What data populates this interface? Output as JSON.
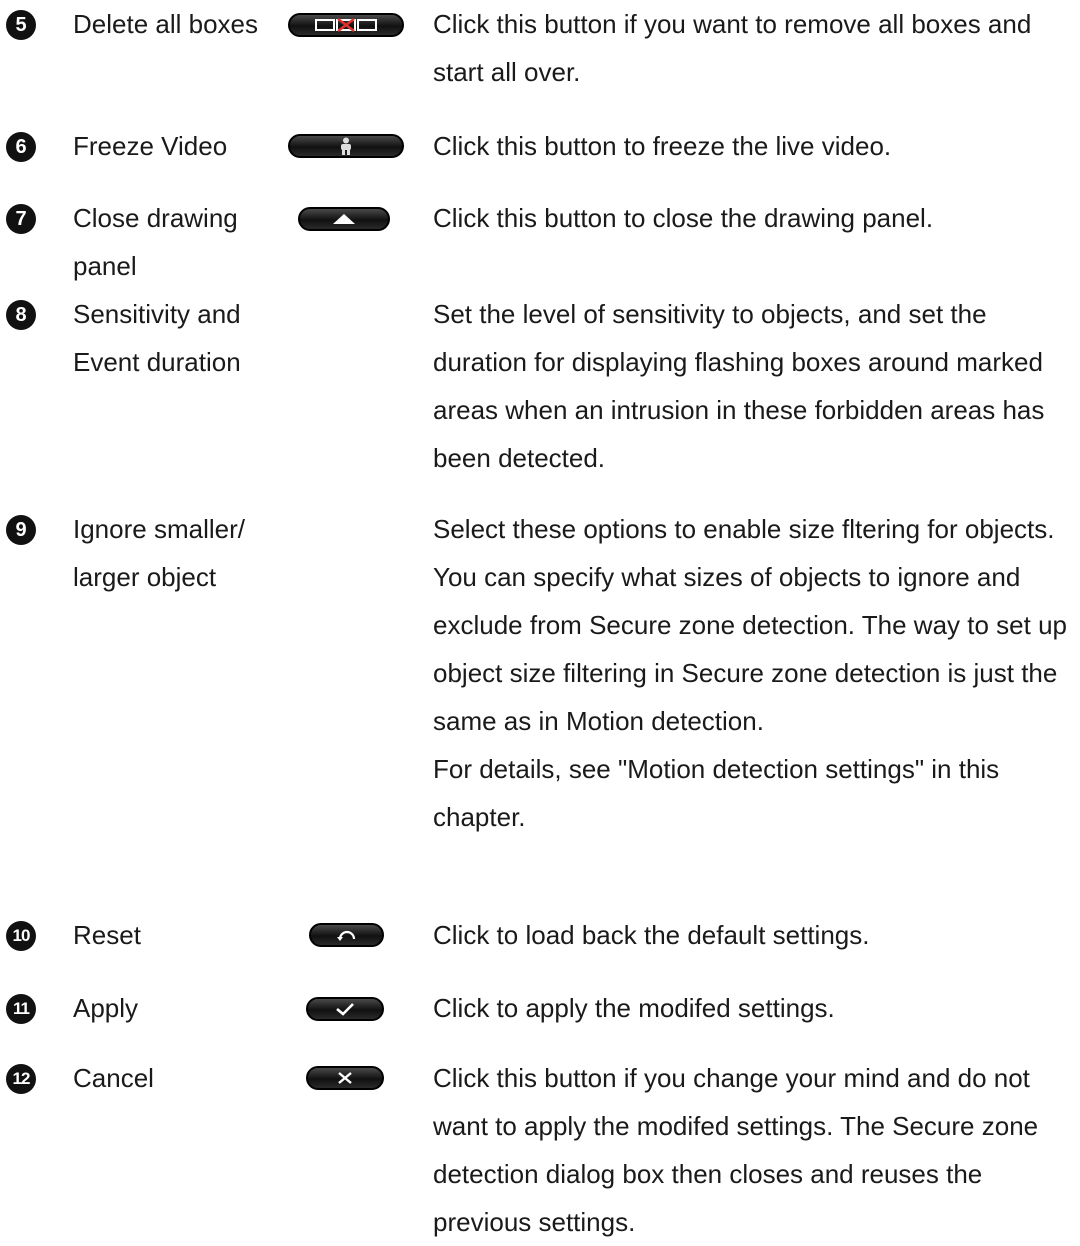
{
  "items": [
    {
      "number": "5",
      "name": "Delete all boxes",
      "icon": "delete-all-boxes-icon",
      "description": "Click this button if you want to remove all boxes and start all over."
    },
    {
      "number": "6",
      "name": "Freeze Video",
      "icon": "freeze-video-icon",
      "description": "Click this button to freeze the live video."
    },
    {
      "number": "7",
      "name": "Close drawing panel",
      "icon": "close-panel-up-arrow-icon",
      "description": "Click this button to close the drawing panel."
    },
    {
      "number": "8",
      "name": "Sensitivity and Event duration",
      "icon": "",
      "description": "Set the level of sensitivity to objects, and set the duration for displaying flashing boxes around marked areas when an intrusion in these forbidden areas has been detected."
    },
    {
      "number": "9",
      "name": "Ignore smaller/ larger object",
      "icon": "",
      "description": "Select these options to enable size fltering for objects. You can specify what sizes of objects to ignore and exclude from Secure zone detection. The way to set up object size filtering in Secure zone detection is just the same as in Motion detection.",
      "description2": "For details, see \"Motion detection settings\" in this chapter."
    },
    {
      "number": "10",
      "name": "Reset",
      "icon": "reset-icon",
      "description": "Click to load back the default settings."
    },
    {
      "number": "11",
      "name": "Apply",
      "icon": "checkmark-icon",
      "description": "Click to apply the modifed settings."
    },
    {
      "number": "12",
      "name": "Cancel",
      "icon": "cancel-x-icon",
      "description": "Click this button if you change your mind and do not want to apply the modifed settings. The Secure zone detection dialog box then closes and reuses the previous settings."
    }
  ]
}
